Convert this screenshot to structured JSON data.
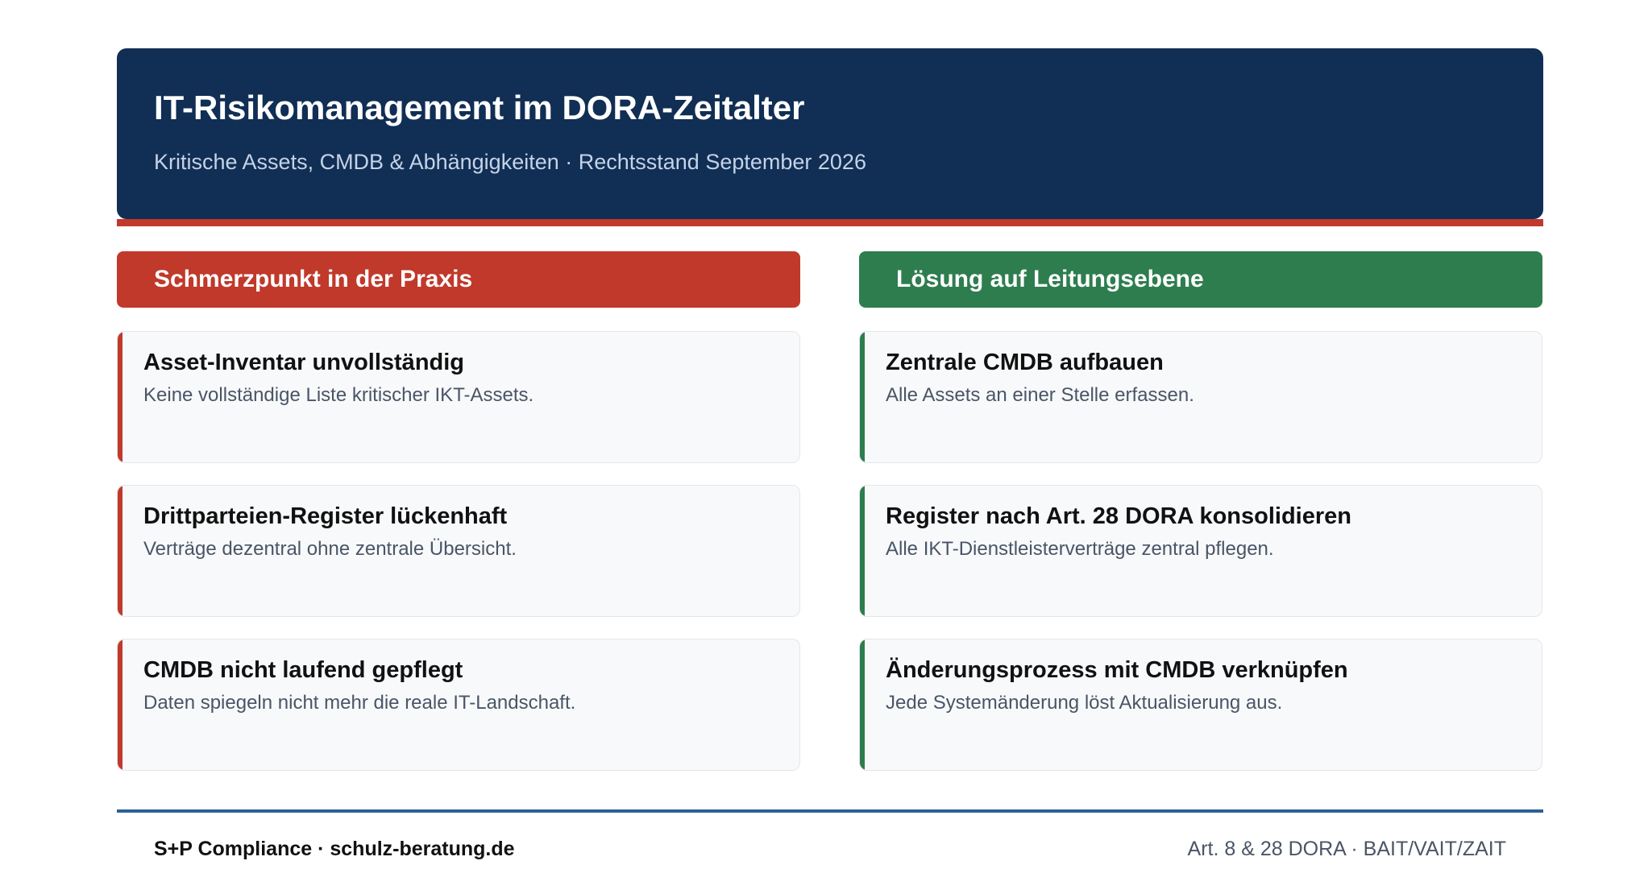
{
  "header": {
    "title": "IT-Risikomanagement im DORA-Zeitalter",
    "subtitle": "Kritische Assets, CMDB & Abhängigkeiten · Rechtsstand September 2026"
  },
  "colors": {
    "navy": "#112e54",
    "pain_red": "#c0392b",
    "solution_green": "#2e7d4f",
    "footer_blue": "#2f5f9a"
  },
  "pain": {
    "heading": "Schmerzpunkt in der Praxis",
    "items": [
      {
        "title": "Asset-Inventar unvollständig",
        "text": "Keine vollständige Liste kritischer IKT-Assets."
      },
      {
        "title": "Drittparteien-Register lückenhaft",
        "text": "Verträge dezentral ohne zentrale Übersicht."
      },
      {
        "title": "CMDB nicht laufend gepflegt",
        "text": "Daten spiegeln nicht mehr die reale IT-Landschaft."
      }
    ]
  },
  "solution": {
    "heading": "Lösung auf Leitungsebene",
    "items": [
      {
        "title": "Zentrale CMDB aufbauen",
        "text": "Alle Assets an einer Stelle erfassen."
      },
      {
        "title": "Register nach Art. 28 DORA konsolidieren",
        "text": "Alle IKT-Dienstleisterverträge zentral pflegen."
      },
      {
        "title": "Änderungsprozess mit CMDB verknüpfen",
        "text": "Jede Systemänderung löst Aktualisierung aus."
      }
    ]
  },
  "footer": {
    "left": "S+P Compliance · schulz-beratung.de",
    "right": "Art. 8 & 28 DORA · BAIT/VAIT/ZAIT"
  }
}
